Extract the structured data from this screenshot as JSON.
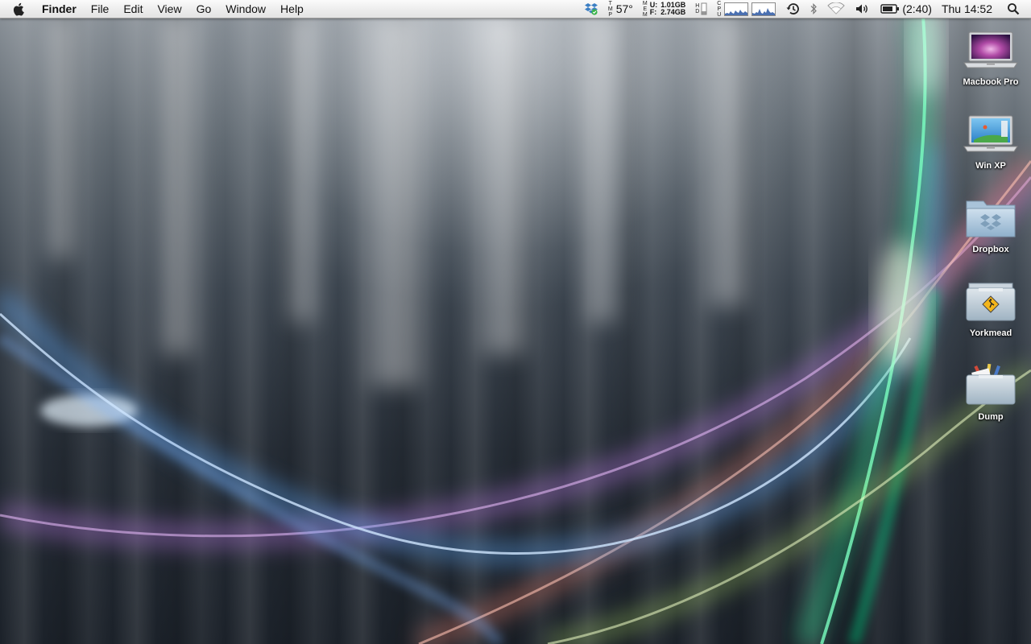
{
  "menubar": {
    "app_name": "Finder",
    "menus": [
      "File",
      "Edit",
      "View",
      "Go",
      "Window",
      "Help"
    ],
    "status": {
      "temperature": "57°",
      "temp_label": [
        "T",
        "M",
        "P"
      ],
      "mem_label": [
        "M",
        "E",
        "M"
      ],
      "mem_used_label": "U:",
      "mem_free_label": "F:",
      "mem_used": "1.01GB",
      "mem_free": "2.74GB",
      "hd_label": [
        "H",
        "D"
      ],
      "cpu_label": [
        "C",
        "P",
        "U"
      ],
      "battery_time": "(2:40)",
      "clock": "Thu 14:52"
    },
    "icons": [
      "apple-icon",
      "dropbox-status-icon",
      "time-machine-icon",
      "bluetooth-icon",
      "wifi-icon",
      "volume-icon",
      "battery-icon",
      "spotlight-icon"
    ]
  },
  "desktop": {
    "icons": [
      {
        "name": "macbook-pro-icon",
        "label": "Macbook Pro"
      },
      {
        "name": "win-xp-icon",
        "label": "Win XP"
      },
      {
        "name": "dropbox-folder-icon",
        "label": "Dropbox"
      },
      {
        "name": "yorkmead-folder-icon",
        "label": "Yorkmead"
      },
      {
        "name": "dump-folder-icon",
        "label": "Dump"
      }
    ]
  },
  "colors": {
    "menubar": "#eeeeee",
    "wallpaper_dark": "#1b2129",
    "label_text": "#ffffff"
  }
}
